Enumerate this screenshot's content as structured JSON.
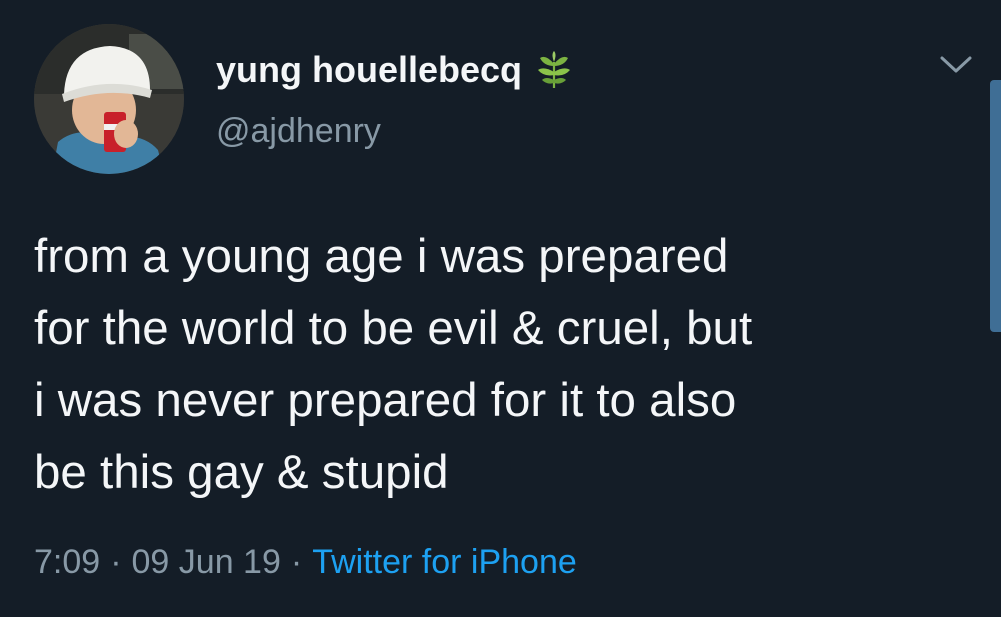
{
  "tweet": {
    "display_name": "yung houellebecq",
    "name_emoji_icon": "herb-icon",
    "handle": "@ajdhenry",
    "text": "from a young age i was prepared\nfor the world to be evil & cruel, but\ni was never prepared for it to also\nbe this gay & stupid",
    "time": "7:09",
    "date": "09 Jun 19",
    "separator": "·",
    "source": "Twitter for iPhone"
  },
  "colors": {
    "background": "#141d27",
    "text": "#f4f6f8",
    "secondary": "#8899a6",
    "link": "#1da1f2"
  }
}
